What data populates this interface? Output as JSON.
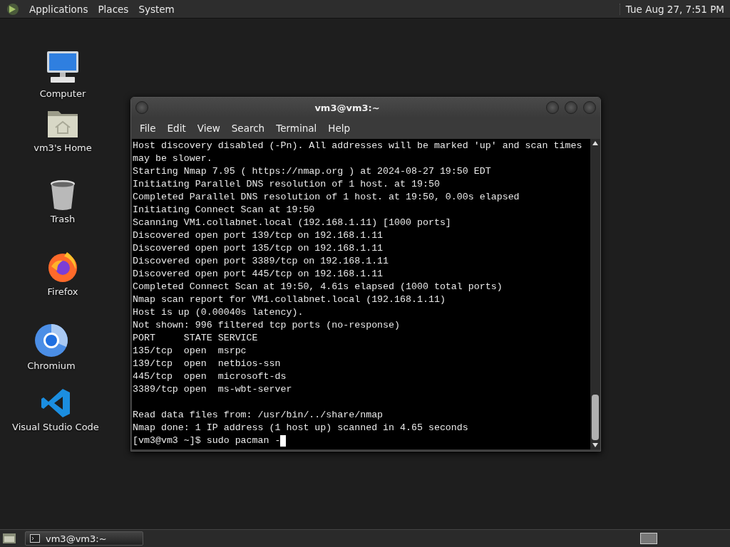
{
  "top_panel": {
    "menus": [
      "Applications",
      "Places",
      "System"
    ],
    "clock": "Tue Aug 27,  7:51 PM"
  },
  "desktop_icons": [
    {
      "kind": "computer",
      "label": "Computer"
    },
    {
      "kind": "home",
      "label": "vm3's Home"
    },
    {
      "kind": "trash",
      "label": "Trash"
    },
    {
      "kind": "firefox",
      "label": "Firefox"
    },
    {
      "kind": "chromium",
      "label": "Chromium"
    },
    {
      "kind": "vscode",
      "label": "Visual Studio Code"
    }
  ],
  "window": {
    "title": "vm3@vm3:~",
    "menu": [
      "File",
      "Edit",
      "View",
      "Search",
      "Terminal",
      "Help"
    ],
    "output_blocks": [
      [
        "Host discovery disabled (-Pn). All addresses will be marked 'up' and scan times",
        "may be slower.",
        "Starting Nmap 7.95 ( https://nmap.org ) at 2024-08-27 19:50 EDT",
        "Initiating Parallel DNS resolution of 1 host. at 19:50",
        "Completed Parallel DNS resolution of 1 host. at 19:50, 0.00s elapsed",
        "Initiating Connect Scan at 19:50",
        "Scanning VM1.collabnet.local (192.168.1.11) [1000 ports]",
        "Discovered open port 139/tcp on 192.168.1.11",
        "Discovered open port 135/tcp on 192.168.1.11",
        "Discovered open port 3389/tcp on 192.168.1.11",
        "Discovered open port 445/tcp on 192.168.1.11",
        "Completed Connect Scan at 19:50, 4.61s elapsed (1000 total ports)",
        "Nmap scan report for VM1.collabnet.local (192.168.1.11)",
        "Host is up (0.00040s latency).",
        "Not shown: 996 filtered tcp ports (no-response)",
        "PORT     STATE SERVICE",
        "135/tcp  open  msrpc",
        "139/tcp  open  netbios-ssn",
        "445/tcp  open  microsoft-ds",
        "3389/tcp open  ms-wbt-server"
      ],
      [
        "Read data files from: /usr/bin/../share/nmap",
        "Nmap done: 1 IP address (1 host up) scanned in 4.65 seconds"
      ]
    ],
    "prompt": "[vm3@vm3 ~]$ sudo pacman -"
  },
  "taskbar": {
    "tasks": [
      {
        "label": "vm3@vm3:~",
        "selected": true
      }
    ]
  }
}
